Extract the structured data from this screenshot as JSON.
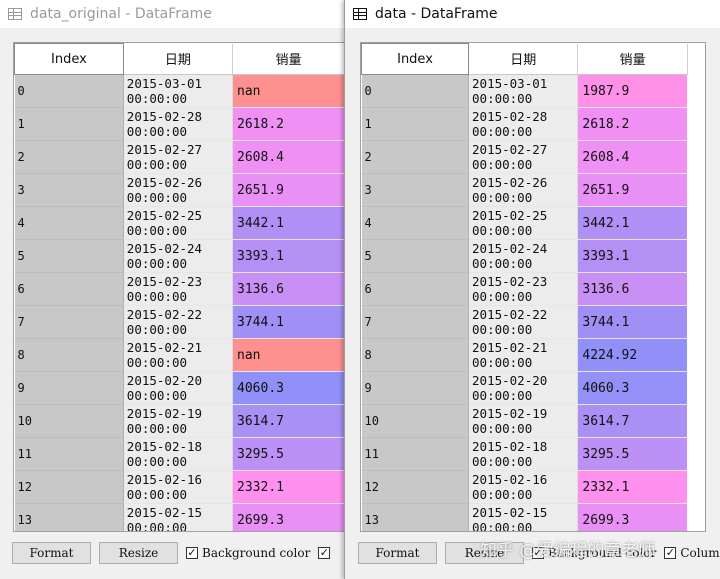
{
  "windows": [
    {
      "title": "data_original - DataFrame",
      "columns": [
        "Index",
        "日期",
        "销量"
      ],
      "rows": [
        {
          "index": "0",
          "date": [
            "2015-03-01",
            "00:00:00"
          ],
          "value": "nan",
          "color": "#ff9090"
        },
        {
          "index": "1",
          "date": [
            "2015-02-28",
            "00:00:00"
          ],
          "value": "2618.2",
          "color": "#f090f5"
        },
        {
          "index": "2",
          "date": [
            "2015-02-27",
            "00:00:00"
          ],
          "value": "2608.4",
          "color": "#f090f5"
        },
        {
          "index": "3",
          "date": [
            "2015-02-26",
            "00:00:00"
          ],
          "value": "2651.9",
          "color": "#e890f5"
        },
        {
          "index": "4",
          "date": [
            "2015-02-25",
            "00:00:00"
          ],
          "value": "3442.1",
          "color": "#b090f5"
        },
        {
          "index": "5",
          "date": [
            "2015-02-24",
            "00:00:00"
          ],
          "value": "3393.1",
          "color": "#b490f5"
        },
        {
          "index": "6",
          "date": [
            "2015-02-23",
            "00:00:00"
          ],
          "value": "3136.6",
          "color": "#c890f5"
        },
        {
          "index": "7",
          "date": [
            "2015-02-22",
            "00:00:00"
          ],
          "value": "3744.1",
          "color": "#a090f5"
        },
        {
          "index": "8",
          "date": [
            "2015-02-21",
            "00:00:00"
          ],
          "value": "nan",
          "color": "#ff9090"
        },
        {
          "index": "9",
          "date": [
            "2015-02-20",
            "00:00:00"
          ],
          "value": "4060.3",
          "color": "#9090f8"
        },
        {
          "index": "10",
          "date": [
            "2015-02-19",
            "00:00:00"
          ],
          "value": "3614.7",
          "color": "#a890f5"
        },
        {
          "index": "11",
          "date": [
            "2015-02-18",
            "00:00:00"
          ],
          "value": "3295.5",
          "color": "#bc90f5"
        },
        {
          "index": "12",
          "date": [
            "2015-02-16",
            "00:00:00"
          ],
          "value": "2332.1",
          "color": "#ff90f0"
        },
        {
          "index": "13",
          "date": [
            "2015-02-15",
            "00:00:00"
          ],
          "value": "2699.3",
          "color": "#e890f5"
        }
      ],
      "buttons": {
        "format": "Format",
        "resize": "Resize"
      },
      "checkboxes": [
        {
          "label": "Background color",
          "checked": true
        },
        {
          "label": "",
          "checked": true
        }
      ]
    },
    {
      "title": "data - DataFrame",
      "columns": [
        "Index",
        "日期",
        "销量"
      ],
      "rows": [
        {
          "index": "0",
          "date": [
            "2015-03-01",
            "00:00:00"
          ],
          "value": "1987.9",
          "color": "#ff90e8"
        },
        {
          "index": "1",
          "date": [
            "2015-02-28",
            "00:00:00"
          ],
          "value": "2618.2",
          "color": "#f090f5"
        },
        {
          "index": "2",
          "date": [
            "2015-02-27",
            "00:00:00"
          ],
          "value": "2608.4",
          "color": "#f090f5"
        },
        {
          "index": "3",
          "date": [
            "2015-02-26",
            "00:00:00"
          ],
          "value": "2651.9",
          "color": "#e890f5"
        },
        {
          "index": "4",
          "date": [
            "2015-02-25",
            "00:00:00"
          ],
          "value": "3442.1",
          "color": "#b090f5"
        },
        {
          "index": "5",
          "date": [
            "2015-02-24",
            "00:00:00"
          ],
          "value": "3393.1",
          "color": "#b490f5"
        },
        {
          "index": "6",
          "date": [
            "2015-02-23",
            "00:00:00"
          ],
          "value": "3136.6",
          "color": "#c890f5"
        },
        {
          "index": "7",
          "date": [
            "2015-02-22",
            "00:00:00"
          ],
          "value": "3744.1",
          "color": "#a090f5"
        },
        {
          "index": "8",
          "date": [
            "2015-02-21",
            "00:00:00"
          ],
          "value": "4224.92",
          "color": "#9090f8"
        },
        {
          "index": "9",
          "date": [
            "2015-02-20",
            "00:00:00"
          ],
          "value": "4060.3",
          "color": "#9490f8"
        },
        {
          "index": "10",
          "date": [
            "2015-02-19",
            "00:00:00"
          ],
          "value": "3614.7",
          "color": "#a890f5"
        },
        {
          "index": "11",
          "date": [
            "2015-02-18",
            "00:00:00"
          ],
          "value": "3295.5",
          "color": "#bc90f5"
        },
        {
          "index": "12",
          "date": [
            "2015-02-16",
            "00:00:00"
          ],
          "value": "2332.1",
          "color": "#ff90f0"
        },
        {
          "index": "13",
          "date": [
            "2015-02-15",
            "00:00:00"
          ],
          "value": "2699.3",
          "color": "#e890f5"
        }
      ],
      "buttons": {
        "format": "Format",
        "resize": "Resize"
      },
      "checkboxes": [
        {
          "label": "Background color",
          "checked": true
        },
        {
          "label": "Colum",
          "checked": true
        }
      ]
    }
  ],
  "watermark": "知乎 @爱编程的章老师"
}
